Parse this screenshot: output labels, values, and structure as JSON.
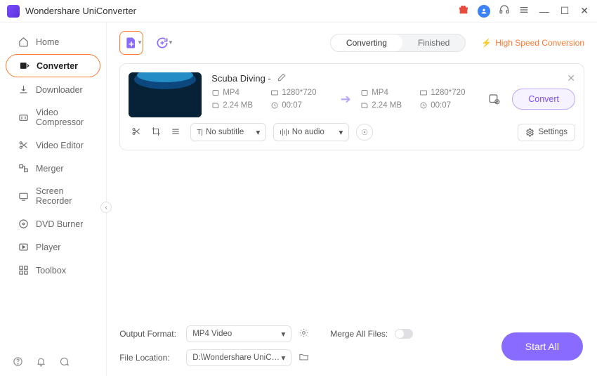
{
  "app": {
    "title": "Wondershare UniConverter"
  },
  "sidebar": {
    "items": [
      {
        "label": "Home"
      },
      {
        "label": "Converter"
      },
      {
        "label": "Downloader"
      },
      {
        "label": "Video Compressor"
      },
      {
        "label": "Video Editor"
      },
      {
        "label": "Merger"
      },
      {
        "label": "Screen Recorder"
      },
      {
        "label": "DVD Burner"
      },
      {
        "label": "Player"
      },
      {
        "label": "Toolbox"
      }
    ]
  },
  "tabs": {
    "converting": "Converting",
    "finished": "Finished"
  },
  "banner": {
    "high_speed": "High Speed Conversion"
  },
  "file": {
    "name": "Scuba Diving - ",
    "src": {
      "format": "MP4",
      "resolution": "1280*720",
      "size": "2.24 MB",
      "duration": "00:07"
    },
    "dst": {
      "format": "MP4",
      "resolution": "1280*720",
      "size": "2.24 MB",
      "duration": "00:07"
    },
    "subtitle": "No subtitle",
    "audio": "No audio",
    "convert_label": "Convert",
    "settings_label": "Settings"
  },
  "bottom": {
    "output_format_label": "Output Format:",
    "output_format_value": "MP4 Video",
    "file_location_label": "File Location:",
    "file_location_value": "D:\\Wondershare UniConverter",
    "merge_label": "Merge All Files:",
    "start_all": "Start All"
  }
}
